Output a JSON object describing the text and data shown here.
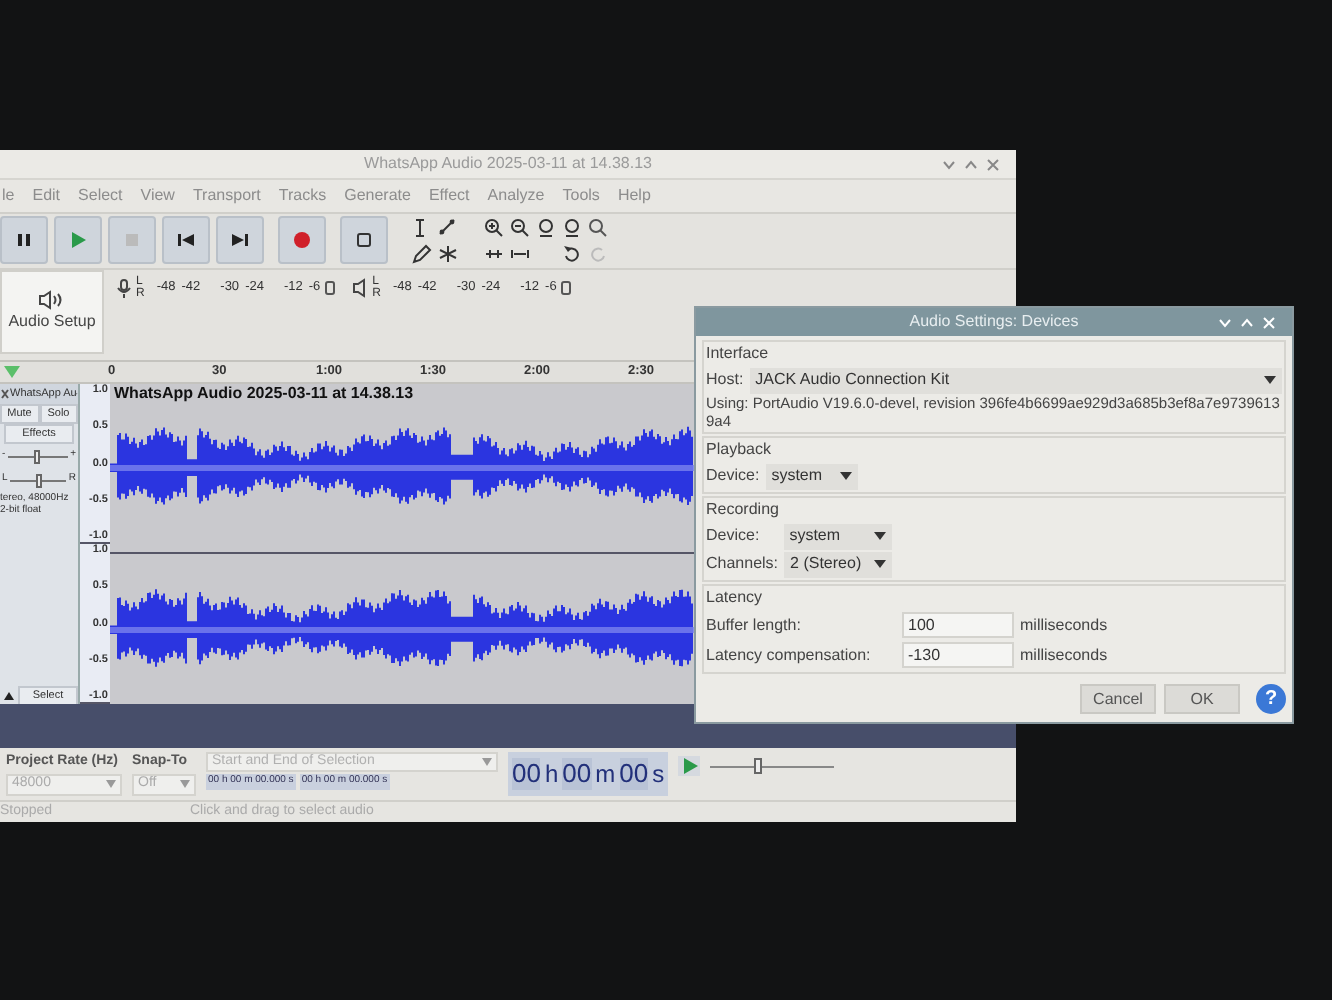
{
  "main_window": {
    "title": "WhatsApp Audio 2025-03-11 at 14.38.13"
  },
  "menu": [
    "le",
    "Edit",
    "Select",
    "View",
    "Transport",
    "Tracks",
    "Generate",
    "Effect",
    "Analyze",
    "Tools",
    "Help"
  ],
  "audio_setup": {
    "label": "Audio Setup"
  },
  "meters": [
    {
      "channels": [
        "L",
        "R"
      ],
      "ticks": [
        "-48",
        "-42",
        "-30",
        "-24",
        "-12",
        "-6"
      ]
    },
    {
      "channels": [
        "L",
        "R"
      ],
      "ticks": [
        "-48",
        "-42",
        "-30",
        "-24",
        "-12",
        "-6"
      ]
    }
  ],
  "timeline": {
    "ticks": [
      "0",
      "30",
      "1:00",
      "1:30",
      "2:00",
      "2:30"
    ]
  },
  "track": {
    "name": "WhatsApp Au",
    "title": "WhatsApp Audio 2025-03-11 at 14.38.13",
    "buttons": [
      "Mute",
      "Solo"
    ],
    "effects": "Effects",
    "gain": {
      "min": "-",
      "max": "+",
      "level": 0.5
    },
    "pan": {
      "min": "L",
      "max": "R",
      "level": 0.5
    },
    "info": [
      "tereo, 48000Hz",
      "2-bit float"
    ],
    "select": "Select",
    "channels": [
      {
        "scale": [
          "1.0",
          "0.5",
          "0.0",
          "-0.5",
          "-1.0"
        ]
      },
      {
        "scale": [
          "1.0",
          "0.5",
          "0.0",
          "-0.5",
          "-1.0"
        ]
      }
    ]
  },
  "bottom_toolbar": {
    "project_rate": {
      "label": "Project Rate (Hz)",
      "value": "48000"
    },
    "snap_to": {
      "label": "Snap-To",
      "value": "Off"
    },
    "selection": {
      "label": "Start and End of Selection",
      "start": "00 h 00 m 00.000 s",
      "end": "00 h 00 m 00.000 s"
    },
    "time": [
      "00",
      "h",
      "00",
      "m",
      "00",
      "s"
    ],
    "speed": {
      "level": 0.38
    }
  },
  "status_bar": {
    "state": "Stopped",
    "hint": "Click and drag to select audio"
  },
  "dialog": {
    "title": "Audio Settings: Devices",
    "interface": {
      "heading": "Interface",
      "host_label": "Host:",
      "host": "JACK Audio Connection Kit",
      "using": "Using: PortAudio V19.6.0-devel, revision 396fe4b6699ae929d3a685b3ef8a7e97396139a4"
    },
    "playback": {
      "heading": "Playback",
      "device_label": "Device:",
      "device": "system"
    },
    "recording": {
      "heading": "Recording",
      "device_label": "Device:",
      "device": "system",
      "channels_label": "Channels:",
      "channels": "2 (Stereo)"
    },
    "latency": {
      "heading": "Latency",
      "rows": [
        {
          "label": "Buffer length:",
          "value": "100",
          "unit": "milliseconds"
        },
        {
          "label": "Latency compensation:",
          "value": "-130",
          "unit": "milliseconds"
        }
      ]
    },
    "buttons": [
      "Cancel",
      "OK"
    ],
    "help": "?"
  }
}
